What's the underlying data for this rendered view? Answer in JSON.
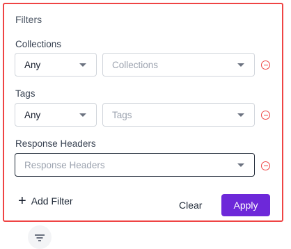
{
  "panel": {
    "title": "Filters",
    "accent_color": "#ef4444"
  },
  "filters": [
    {
      "label": "Collections",
      "operator": "Any",
      "placeholder": "Collections"
    },
    {
      "label": "Tags",
      "operator": "Any",
      "placeholder": "Tags"
    },
    {
      "label": "Response Headers",
      "placeholder": "Response Headers"
    }
  ],
  "actions": {
    "add_filter_label": "Add Filter",
    "clear_label": "Clear",
    "apply_label": "Apply",
    "apply_color": "#6d28d9"
  },
  "icons": {
    "remove": "minus-circle-icon",
    "add": "plus-icon",
    "dropdown": "chevron-down-icon",
    "filter_toggle": "filter-icon"
  }
}
